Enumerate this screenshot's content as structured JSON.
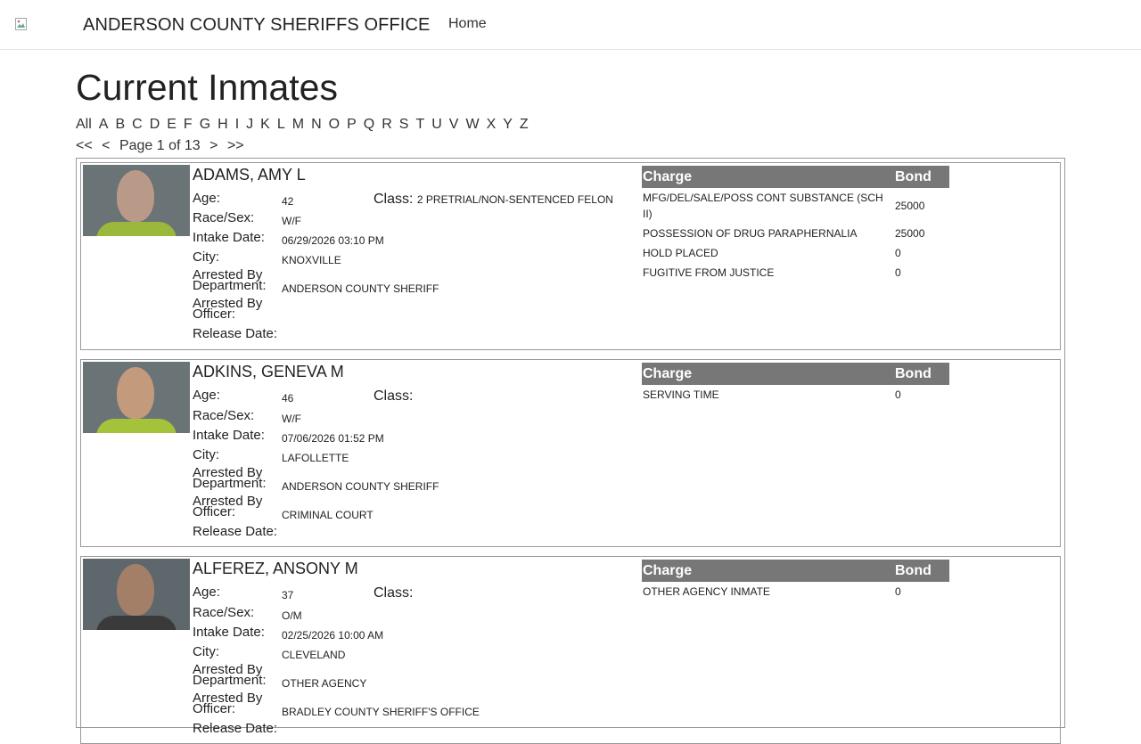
{
  "navbar": {
    "title": "ANDERSON COUNTY SHERIFFS OFFICE",
    "home": "Home"
  },
  "page_title": "Current Inmates",
  "alphabet": [
    "All",
    "A",
    "B",
    "C",
    "D",
    "E",
    "F",
    "G",
    "H",
    "I",
    "J",
    "K",
    "L",
    "M",
    "N",
    "O",
    "P",
    "Q",
    "R",
    "S",
    "T",
    "U",
    "V",
    "W",
    "X",
    "Y",
    "Z"
  ],
  "pager": {
    "first": "<<",
    "prev": "<",
    "label": "Page 1 of 13",
    "next": ">",
    "last": ">>"
  },
  "labels": {
    "age": "Age:",
    "class": "Class:",
    "race_sex": "Race/Sex:",
    "intake": "Intake Date:",
    "city": "City:",
    "arrested_dept_1": "Arrested By",
    "arrested_dept_2": "Department:",
    "arrested_officer_1": "Arrested By",
    "arrested_officer_2": "Officer:",
    "release": "Release Date:",
    "charge": "Charge",
    "bond": "Bond"
  },
  "inmates": [
    {
      "name": "ADAMS, AMY L",
      "age": "42",
      "class": "2 PRETRIAL/NON-SENTENCED FELON",
      "race_sex": "W/F",
      "intake": "06/29/2026 03:10 PM",
      "city": "KNOXVILLE",
      "department": "ANDERSON COUNTY SHERIFF",
      "officer": "",
      "release": "",
      "charges": [
        {
          "charge": "MFG/DEL/SALE/POSS CONT SUBSTANCE (SCH II)",
          "bond": "25000"
        },
        {
          "charge": "POSSESSION OF DRUG PARAPHERNALIA",
          "bond": "25000"
        },
        {
          "charge": "HOLD PLACED",
          "bond": "0"
        },
        {
          "charge": "FUGITIVE FROM JUSTICE",
          "bond": "0"
        }
      ]
    },
    {
      "name": "ADKINS, GENEVA M",
      "age": "46",
      "class": "",
      "race_sex": "W/F",
      "intake": "07/06/2026 01:52 PM",
      "city": "LAFOLLETTE",
      "department": "ANDERSON COUNTY SHERIFF",
      "officer": "CRIMINAL COURT",
      "release": "",
      "charges": [
        {
          "charge": "SERVING TIME",
          "bond": "0"
        }
      ]
    },
    {
      "name": "ALFEREZ, ANSONY M",
      "age": "37",
      "class": "",
      "race_sex": "O/M",
      "intake": "02/25/2026 10:00 AM",
      "city": "CLEVELAND",
      "department": "OTHER AGENCY",
      "officer": "BRADLEY COUNTY SHERIFF'S OFFICE",
      "release": "",
      "charges": [
        {
          "charge": "OTHER AGENCY INMATE",
          "bond": "0"
        }
      ]
    }
  ]
}
